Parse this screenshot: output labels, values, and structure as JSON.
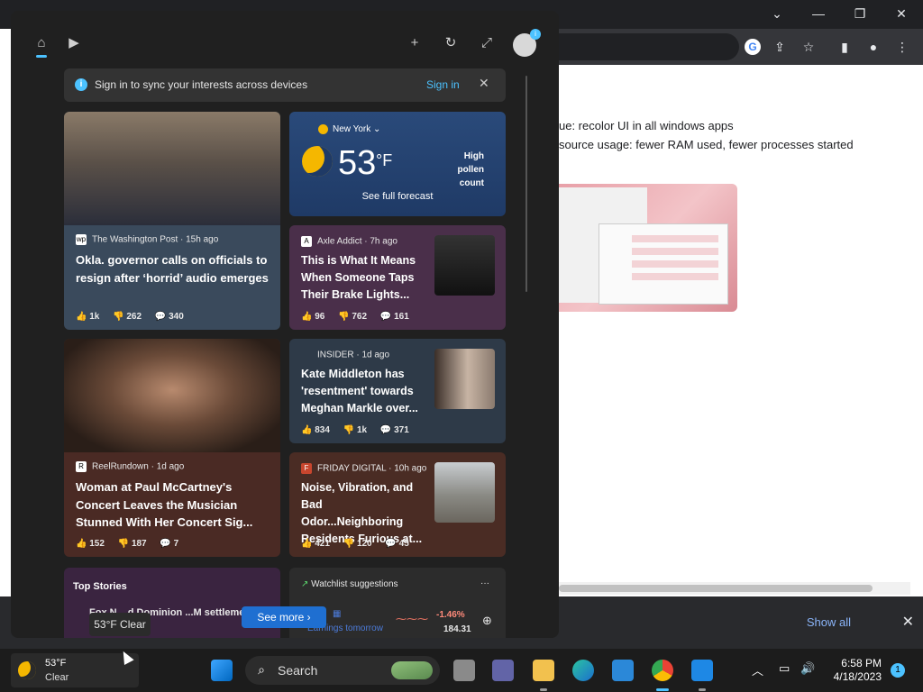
{
  "browser": {
    "page_line_1": "ue: recolor UI in all windows apps",
    "page_line_2": "source usage: fewer RAM used, fewer processes started",
    "controls": {
      "minimize": "—",
      "restore": "❐",
      "close": "✕",
      "dropdown": "⌄"
    }
  },
  "shelf": {
    "show_all_label": "Show all",
    "close_label": "✕"
  },
  "widgets": {
    "signin_banner": {
      "text": "Sign in to sync your interests across devices",
      "link": "Sign in"
    },
    "weather": {
      "location": "New York",
      "temperature": "53",
      "unit": "°F",
      "pollen_level": "High",
      "pollen_label": "pollen count",
      "forecast_link": "See full forecast"
    },
    "cards": [
      {
        "source": "The Washington Post · 15h ago",
        "headline": "Okla. governor calls on officials to resign after ‘horrid’ audio emerges",
        "likes": "1k",
        "dislikes": "262",
        "comments": "340"
      },
      {
        "source": "Axle Addict · 7h ago",
        "headline": "This is What It Means When Someone Taps Their Brake Lights...",
        "likes": "96",
        "dislikes": "762",
        "comments": "161"
      },
      {
        "source": "ReelRundown · 1d ago",
        "headline": "Woman at Paul McCartney's Concert Leaves the Musician Stunned With Her Concert Sig...",
        "likes": "152",
        "dislikes": "187",
        "comments": "7"
      },
      {
        "source": "INSIDER · 1d ago",
        "headline": "Kate Middleton has 'resentment' towards Meghan Markle over...",
        "likes": "834",
        "dislikes": "1k",
        "comments": "371"
      },
      {
        "source": "FRIDAY DIGITAL · 10h ago",
        "headline": "Noise, Vibration, and Bad Odor...Neighboring Residents Furious at...",
        "likes": "421",
        "dislikes": "120",
        "comments": "45"
      }
    ],
    "top_stories": {
      "title": "Top Stories",
      "item": "Fox N... d Dominion ...M settlement..."
    },
    "watchlist": {
      "title": "Watchlist suggestions",
      "earnings": "Earnings tomorrow",
      "change": "-1.46%",
      "price": "184.31"
    },
    "see_more": "See more",
    "weather_tooltip": "53°F Clear"
  },
  "taskbar": {
    "weather_temp": "53°F",
    "weather_cond": "Clear",
    "search_placeholder": "Search",
    "time": "6:58 PM",
    "date": "4/18/2023",
    "notifications": "1"
  }
}
